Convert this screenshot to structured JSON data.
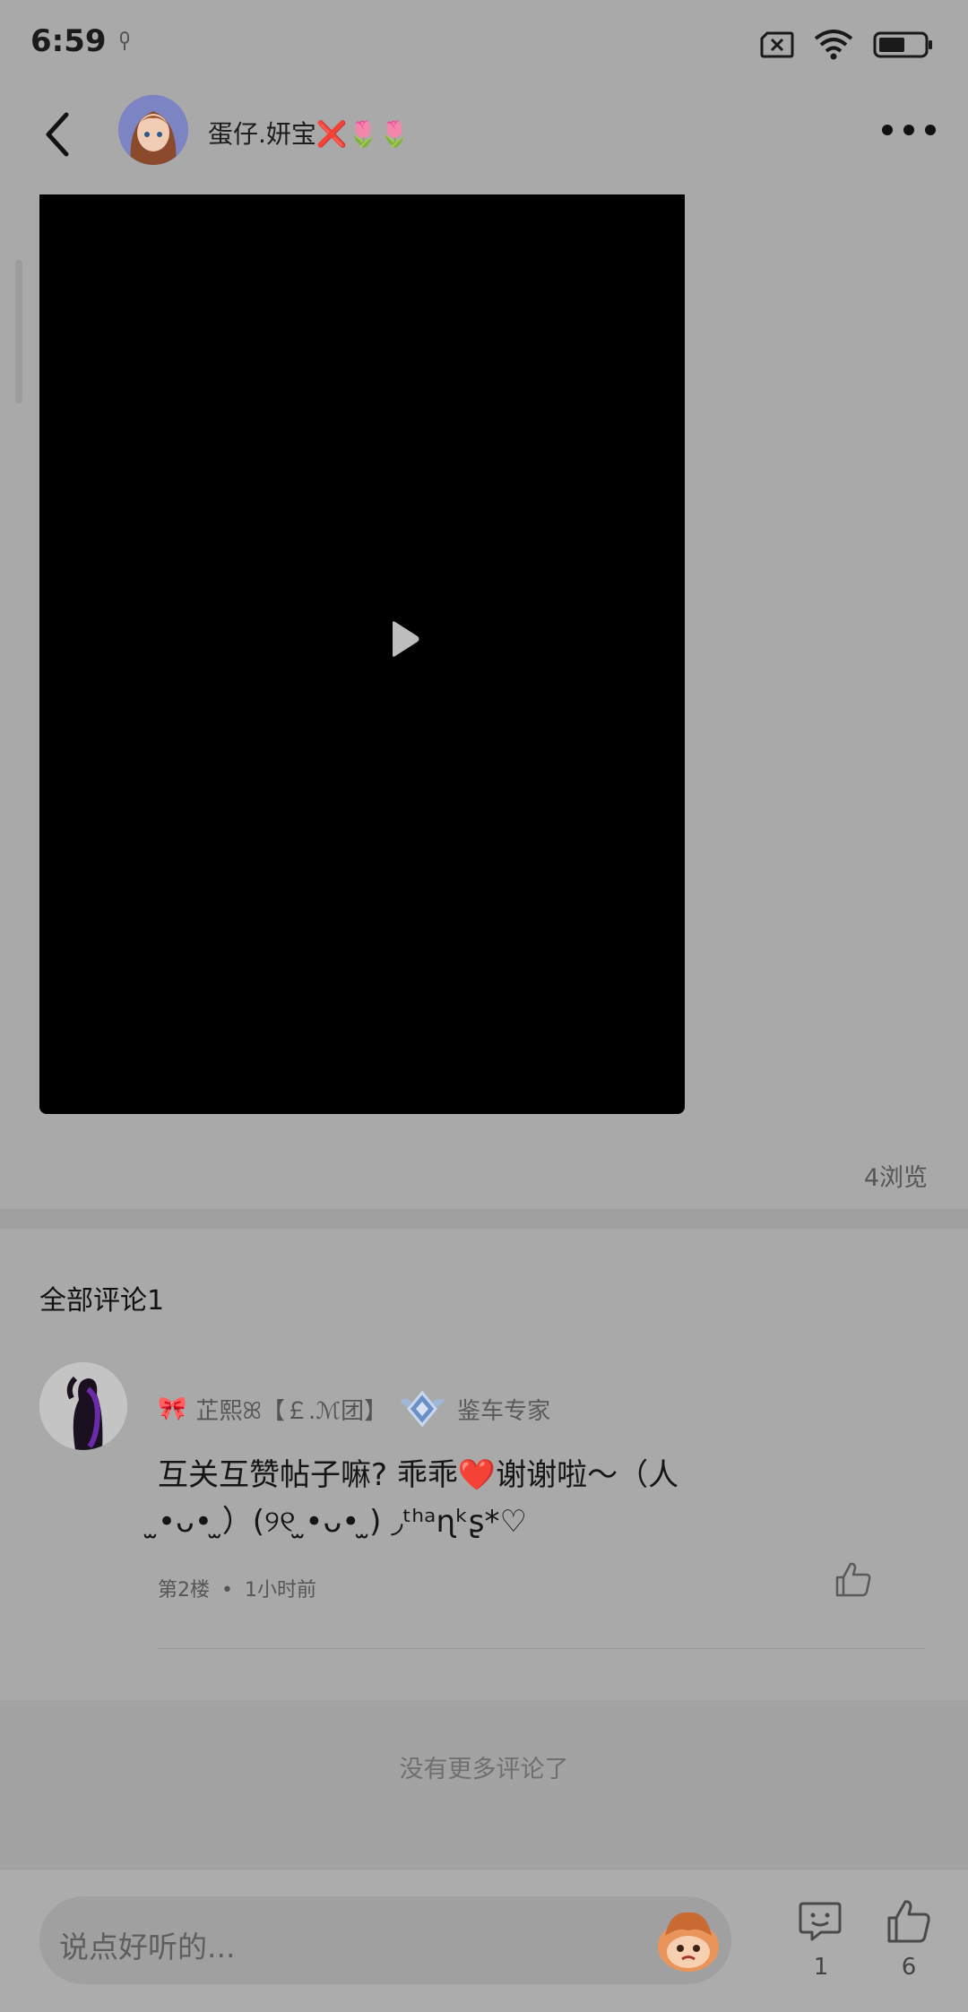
{
  "status_bar": {
    "time": "6:59",
    "icons": [
      "mic-icon",
      "sim-error-icon",
      "wifi-icon",
      "battery-icon"
    ]
  },
  "header": {
    "username": "蛋仔.妍宝❌🌷🌷",
    "back_icon": "back-arrow-icon",
    "more_icon": "more-dots-icon"
  },
  "video": {
    "play_icon": "play-icon"
  },
  "post": {
    "views": "4浏览"
  },
  "comments": {
    "title": "全部评论1",
    "items": [
      {
        "name_prefix": "🎀",
        "name": "芷熙ꕤ【￡.ℳ团】",
        "badge": "鉴车专家",
        "text": "互关互赞帖子嘛? 乖乖❤️谢谢啦～（人 ̫•ᴗ• ̫）(୨୧ ̫•ᴗ• ̫) ◞ᵗʰᵃɳᵏʂ*♡",
        "floor": "第2楼",
        "dot": "•",
        "time": "1小时前"
      }
    ],
    "no_more": "没有更多评论了"
  },
  "bottom_bar": {
    "placeholder": "说点好听的...",
    "comment_count": "1",
    "like_count": "6"
  }
}
